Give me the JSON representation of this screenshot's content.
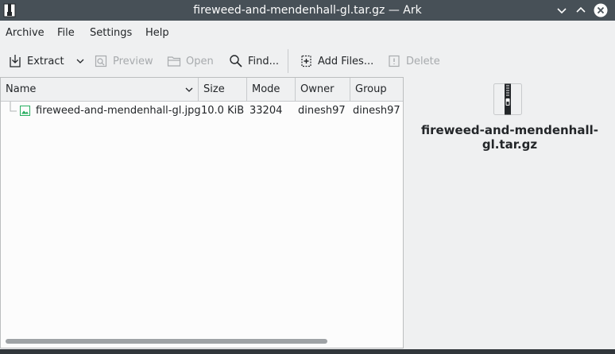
{
  "window": {
    "title": "fireweed-and-mendenhall-gl.tar.gz — Ark",
    "controls": [
      "minimize",
      "maximize",
      "close"
    ]
  },
  "menu": {
    "items": [
      "Archive",
      "File",
      "Settings",
      "Help"
    ]
  },
  "toolbar": {
    "extract": "Extract",
    "preview": "Preview",
    "open": "Open",
    "find": "Find...",
    "add_files": "Add Files...",
    "delete": "Delete"
  },
  "table": {
    "columns": [
      "Name",
      "Size",
      "Mode",
      "Owner",
      "Group"
    ],
    "rows": [
      {
        "name": "fireweed-and-mendenhall-gl.jpg",
        "size": "10.0 KiB",
        "mode": "33204",
        "owner": "dinesh97",
        "group": "dinesh97"
      }
    ]
  },
  "info_panel": {
    "archive_name": "fireweed-and-mendenhall-gl.tar.gz",
    "icon": "archive-zip-icon"
  },
  "colors": {
    "titlebar": "#475057",
    "background": "#eff0f1",
    "view_background": "#fcfcfc",
    "disabled_text": "#a7aaad"
  }
}
